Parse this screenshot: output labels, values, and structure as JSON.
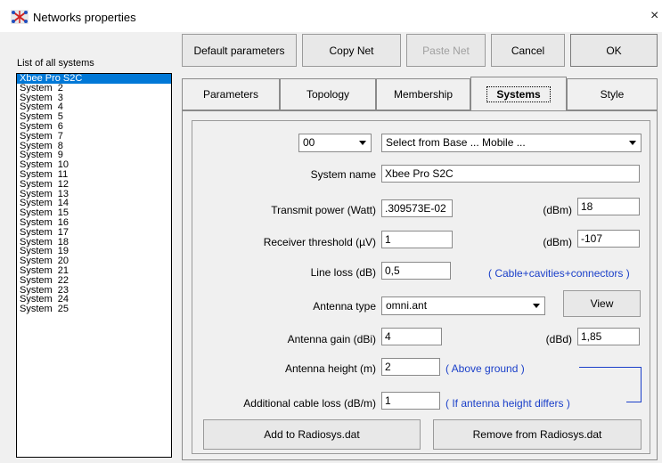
{
  "window": {
    "title": "Networks properties",
    "close_glyph": "×",
    "icon": "network-app-icon"
  },
  "systems_list": {
    "label": "List of all systems",
    "items": [
      "Xbee Pro S2C",
      "System  2",
      "System  3",
      "System  4",
      "System  5",
      "System  6",
      "System  7",
      "System  8",
      "System  9",
      "System  10",
      "System  11",
      "System  12",
      "System  13",
      "System  14",
      "System  15",
      "System  16",
      "System  17",
      "System  18",
      "System  19",
      "System  20",
      "System  21",
      "System  22",
      "System  23",
      "System  24",
      "System  25"
    ],
    "selected_index": 0
  },
  "toolbar": {
    "default_parameters": "Default parameters",
    "copy_net": "Copy Net",
    "paste_net": "Paste Net",
    "cancel": "Cancel",
    "ok": "OK"
  },
  "tabs": [
    "Parameters",
    "Topology",
    "Membership",
    "Systems",
    "Style"
  ],
  "active_tab": "Systems",
  "systems": {
    "base_index": "00",
    "base_select": "Select from Base ... Mobile ...",
    "system_name_label": "System name",
    "system_name": "Xbee Pro S2C",
    "transmit_power_label": "Transmit power (Watt)",
    "transmit_power": ".309573E-02",
    "dbm_label": "(dBm)",
    "transmit_dbm": "18",
    "receiver_threshold_label": "Receiver threshold (µV)",
    "receiver_threshold": "1",
    "receiver_dbm": "-107",
    "line_loss_label": "Line loss (dB)",
    "line_loss": "0,5",
    "line_loss_note": "( Cable+cavities+connectors )",
    "antenna_type_label": "Antenna type",
    "antenna_type": "omni.ant",
    "view_button": "View",
    "antenna_gain_label": "Antenna gain (dBi)",
    "antenna_gain": "4",
    "dbd_label": "(dBd)",
    "antenna_gain_dbd": "1,85",
    "antenna_height_label": "Antenna height (m)",
    "antenna_height": "2",
    "antenna_height_note": "( Above ground )",
    "additional_loss_label": "Additional cable loss (dB/m)",
    "additional_loss": "1",
    "additional_loss_note": "( If antenna height differs )",
    "add_button": "Add to Radiosys.dat",
    "remove_button": "Remove from Radiosys.dat"
  },
  "colors": {
    "selection": "#0078d7",
    "note": "#1a3fc9",
    "dialog": "#f0f0f0"
  }
}
